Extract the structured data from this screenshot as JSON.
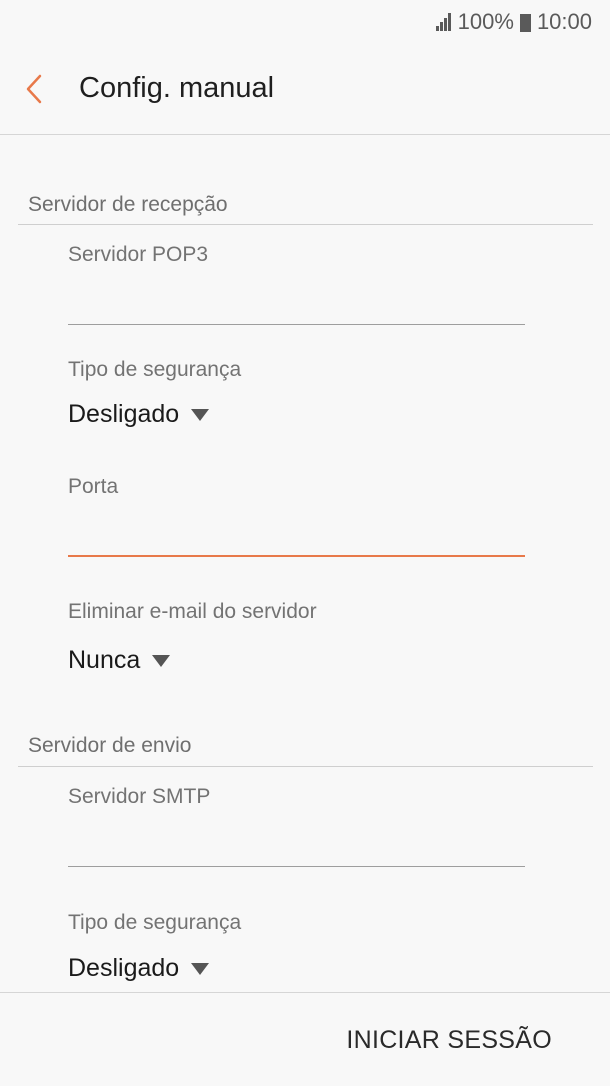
{
  "status": {
    "battery": "100%",
    "time": "10:00"
  },
  "header": {
    "title": "Config. manual"
  },
  "incoming": {
    "section_title": "Servidor de recepção",
    "server_label": "Servidor POP3",
    "server_value": "",
    "security_label": "Tipo de segurança",
    "security_value": "Desligado",
    "port_label": "Porta",
    "port_value": "",
    "delete_label": "Eliminar e-mail do servidor",
    "delete_value": "Nunca"
  },
  "outgoing": {
    "section_title": "Servidor de envio",
    "server_label": "Servidor SMTP",
    "server_value": "",
    "security_label": "Tipo de segurança",
    "security_value": "Desligado"
  },
  "footer": {
    "login_label": "INICIAR SESSÃO"
  },
  "colors": {
    "accent": "#e8794a"
  }
}
